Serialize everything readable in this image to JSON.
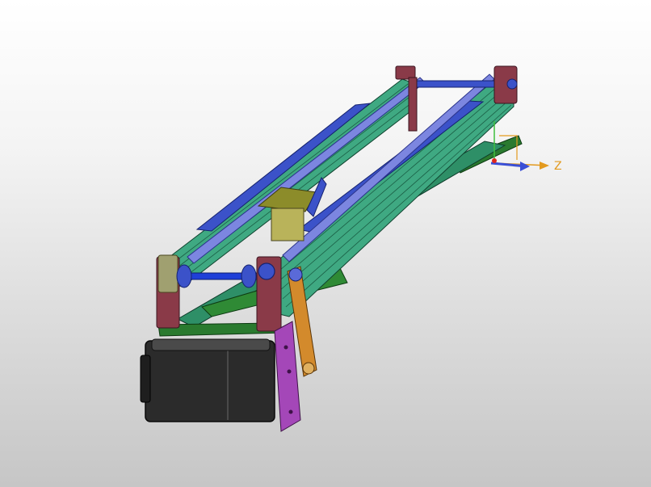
{
  "viewport": {
    "background_top": "#ffffff",
    "background_bottom": "#c6c6c6"
  },
  "triad": {
    "z_label": "Z",
    "z_axis_color": "#e39a1e",
    "x_axis_color": "#3a4fd6",
    "y_axis_color": "#3fbf3f",
    "origin_color": "#e0261e"
  },
  "model": {
    "description_icon": "cad-assembly-icon",
    "colors": {
      "extrusion": "#3fa982",
      "extrusion_dark": "#1f6e52",
      "rail": "#3b52c9",
      "rail_light": "#7c86e0",
      "end_block": "#8a3a48",
      "base_plate": "#2a7a2f",
      "motor": "#2b2b2b",
      "motor_light": "#4a4a4a",
      "motor_mount": "#a447b8",
      "crank": "#d38a2c",
      "carriage": "#8c8c2a",
      "shaft": "#1f3fd8"
    }
  }
}
